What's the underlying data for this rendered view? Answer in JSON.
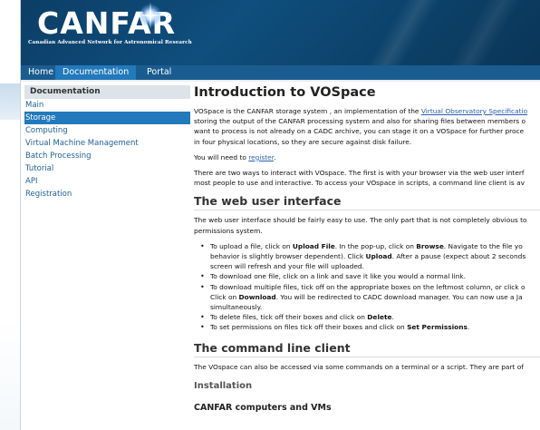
{
  "header": {
    "logo_text": "CANFAR",
    "logo_subtitle": "Canadian Advanced Network for Astronomical Research"
  },
  "nav": {
    "items": [
      "Home",
      "Documentation",
      "Portal"
    ],
    "active": "Documentation"
  },
  "sidebar": {
    "title": "Documentation",
    "items": [
      "Main",
      "Storage",
      "Computing",
      "Virtual Machine Management",
      "Batch Processing",
      "Tutorial",
      "API",
      "Registration"
    ],
    "active": "Storage"
  },
  "main": {
    "title": "Introduction to VOSpace",
    "intro_lines": [
      "VOSpace is the CANFAR storage system , an implementation of the ",
      "storing the output of the CANFAR processing system and also for sharing files between members o",
      "want to process is not already on a CADC archive, you can stage it on a VOSpace for further proce",
      "in four physical locations, so they are secure against disk failure."
    ],
    "intro_link": "Virtual Observatory Specificatio",
    "register_prefix": "You will need to ",
    "register_link": "register",
    "register_suffix": ".",
    "ways_lines": [
      "There are two ways to interact with VOspace. The first is with your browser via the web user interf",
      "most people to use and interactive. To access your VOspace in scripts, a command line client is av"
    ],
    "web_ui_heading": "The web user interface",
    "web_ui_lines": [
      "The web user interface should be fairly easy to use. The only part that is not completely obvious to",
      "permissions system."
    ],
    "bullets": {
      "upload": {
        "p1": "To upload a file, click on ",
        "b1": "Upload File",
        "p2": ". In the pop-up, click on ",
        "b2": "Browse",
        "p3": ". Navigate to the file yo",
        "line2a": "behavior is slightly browser dependent). Click ",
        "line2b": "Upload",
        "line2c": ". After a pause (expect about 2 seconds",
        "line3": "screen will refresh and your file will uploaded."
      },
      "download_one": "To download one file, click on a link and save it like you would a normal link.",
      "download_multi": {
        "line1": "To download multiple files, tick off on the appropriate boxes on the leftmost column, or click o",
        "line2a": "Click on ",
        "line2b": "Download",
        "line2c": ". You will be redirected to CADC download manager. You can now use a Ja",
        "line3": "simultaneously."
      },
      "delete": {
        "p1": "To delete files, tick off their boxes and click on ",
        "b1": "Delete",
        "p2": "."
      },
      "permissions": {
        "p1": "To set permissions on files tick off their boxes and click on ",
        "b1": "Set Permissions",
        "p2": "."
      }
    },
    "cli_heading": "The command line client",
    "cli_line": "The VOspace can also be accessed via some commands on a terminal or a script. They are part of",
    "installation_heading": "Installation",
    "canfar_computers_heading": "CANFAR computers and VMs"
  }
}
